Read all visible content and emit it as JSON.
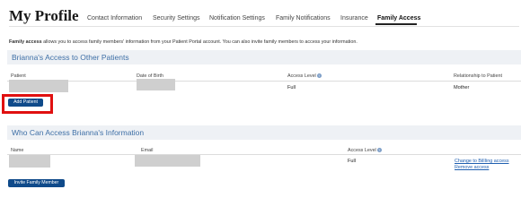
{
  "page": {
    "title": "My Profile"
  },
  "tabs": [
    {
      "label": "Contact Information"
    },
    {
      "label": "Security Settings"
    },
    {
      "label": "Notification Settings"
    },
    {
      "label": "Family Notifications"
    },
    {
      "label": "Insurance"
    },
    {
      "label": "Family Access",
      "active": true
    }
  ],
  "intro": {
    "bold": "Family access",
    "text": "allows you to access family members' information from your Patient Portal account. You can also invite family members to access your information."
  },
  "access_to_others": {
    "heading": "Brianna's Access to Other Patients",
    "columns": [
      "Patient",
      "Date of Birth",
      "Access Level",
      "Relationship to Patient"
    ],
    "rows": [
      {
        "patient": "",
        "dob": "",
        "access_level": "Full",
        "relationship": "Mother"
      }
    ],
    "add_button": "Add Patient"
  },
  "who_can_access": {
    "heading": "Who Can Access Brianna's Information",
    "columns": [
      "Name",
      "Email",
      "Access Level"
    ],
    "rows": [
      {
        "name": "",
        "email": "",
        "access_level": "Full",
        "links": [
          "Change to BillIing access",
          "Remove access"
        ]
      }
    ],
    "invite_button": "Invite Family Member"
  },
  "colors": {
    "section_bg": "#eef1f5",
    "section_heading": "#3e6fa6",
    "button_bg": "#0f4a8a",
    "highlight": "#e01010",
    "link": "#1f5fb0"
  }
}
